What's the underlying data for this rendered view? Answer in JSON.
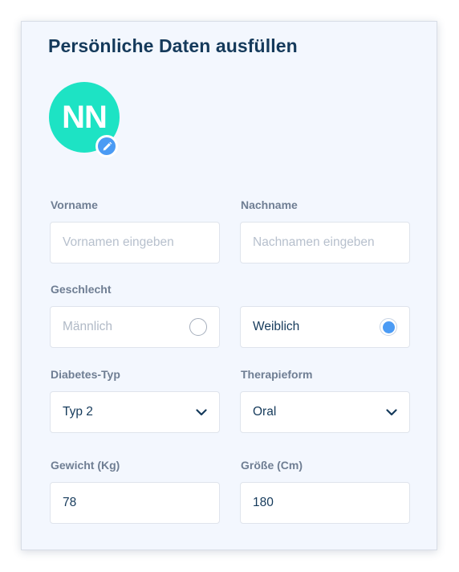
{
  "form": {
    "title": "Persönliche Daten ausfüllen",
    "avatar": {
      "initials": "NN",
      "color": "#1de3c4",
      "edit_icon": "pencil-icon"
    },
    "vorname": {
      "label": "Vorname",
      "placeholder": "Vornamen eingeben",
      "value": ""
    },
    "nachname": {
      "label": "Nachname",
      "placeholder": "Nachnamen eingeben",
      "value": ""
    },
    "geschlecht": {
      "label": "Geschlecht",
      "options": [
        {
          "label": "Männlich",
          "selected": false
        },
        {
          "label": "Weiblich",
          "selected": true
        }
      ]
    },
    "diabetes_typ": {
      "label": "Diabetes-Typ",
      "value": "Typ 2"
    },
    "therapieform": {
      "label": "Therapieform",
      "value": "Oral"
    },
    "gewicht": {
      "label": "Gewicht (Kg)",
      "value": "78"
    },
    "groesse": {
      "label": "Größe (Cm)",
      "value": "180"
    }
  },
  "colors": {
    "title": "#153a5b",
    "label": "#6f7e93",
    "accent": "#4b9bf4",
    "card_background": "#f3f7fe"
  }
}
